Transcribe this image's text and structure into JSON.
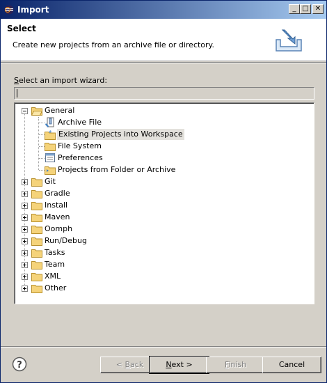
{
  "window": {
    "title": "Import",
    "minimize": "_",
    "maximize": "□",
    "close": "✕"
  },
  "header": {
    "title": "Select",
    "description": "Create new projects from an archive file or directory."
  },
  "wizard_label": {
    "mnemonic": "S",
    "rest": "elect an import wizard:"
  },
  "filter": {
    "value": ""
  },
  "tree": {
    "general": "General",
    "children": [
      "Archive File",
      "Existing Projects into Workspace",
      "File System",
      "Preferences",
      "Projects from Folder or Archive"
    ],
    "selected": "Existing Projects into Workspace",
    "collapsed": [
      "Git",
      "Gradle",
      "Install",
      "Maven",
      "Oomph",
      "Run/Debug",
      "Tasks",
      "Team",
      "XML",
      "Other"
    ]
  },
  "buttons": {
    "back_pre": "< ",
    "back_mn": "B",
    "back_post": "ack",
    "next_mn": "N",
    "next_post": "ext >",
    "finish_mn": "F",
    "finish_post": "inish",
    "cancel": "Cancel"
  },
  "colors": {
    "title_start": "#0a246a",
    "title_end": "#a6caf0",
    "folder": "#f5d37a"
  }
}
